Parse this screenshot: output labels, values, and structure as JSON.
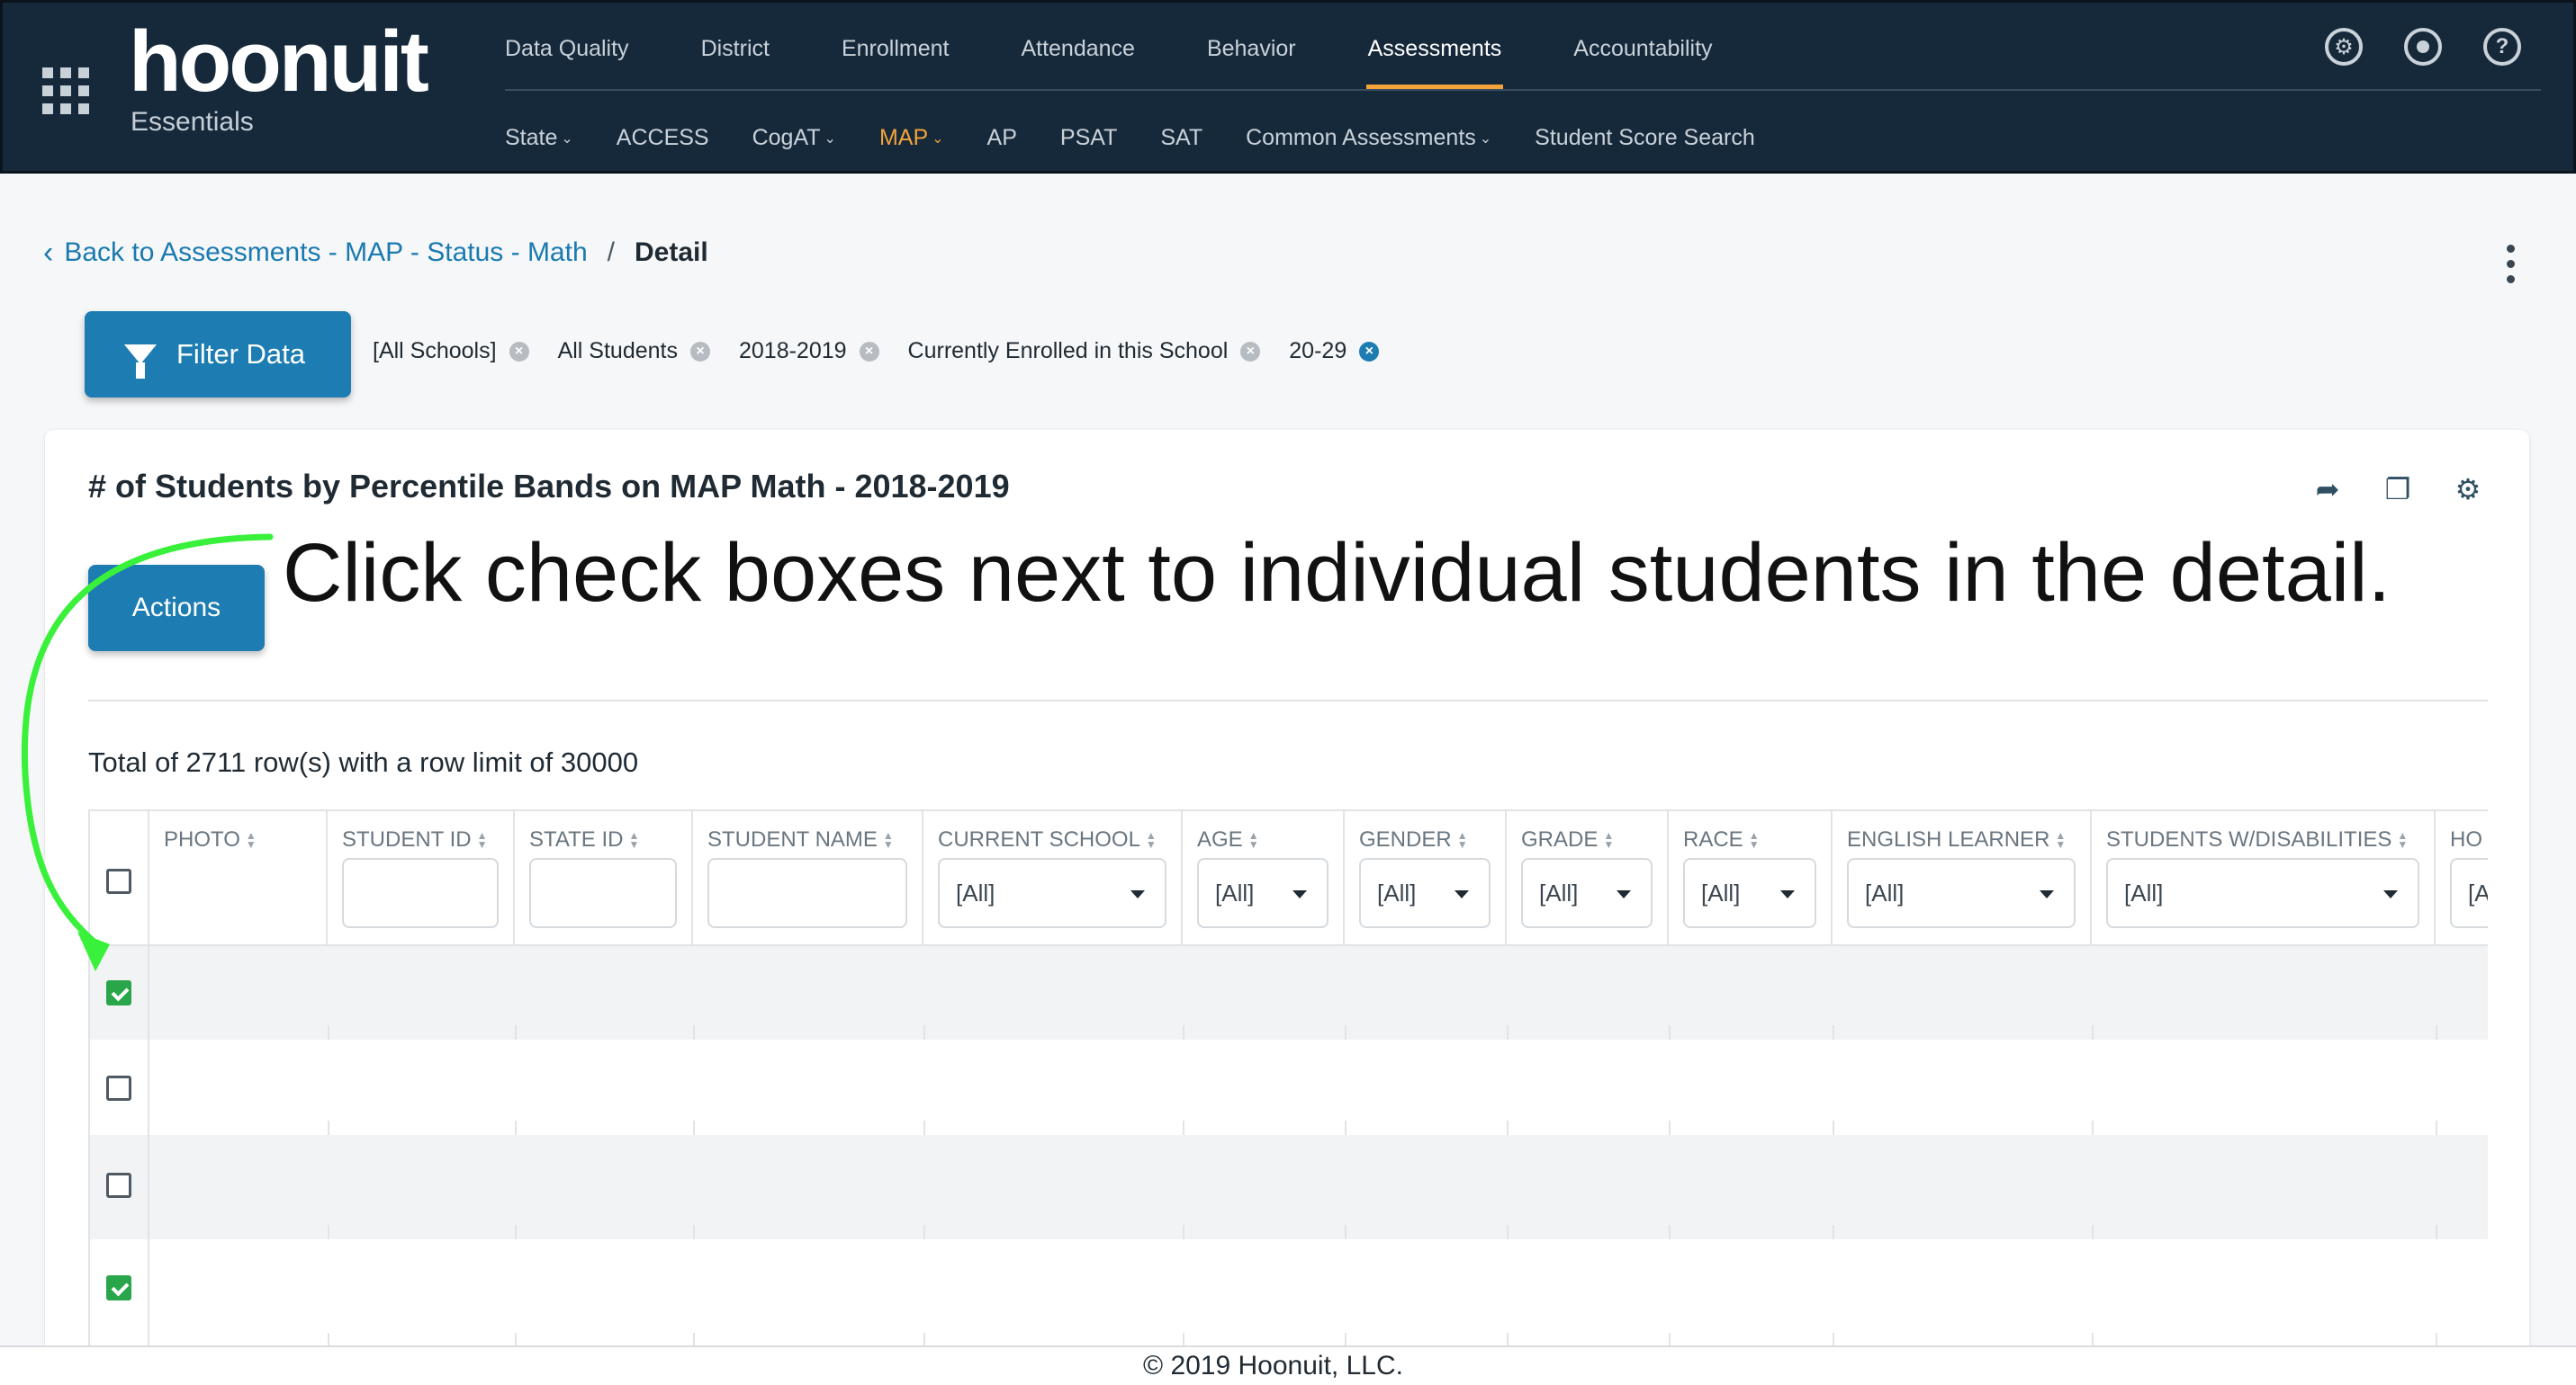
{
  "app": {
    "logo": "hoonuit",
    "logo_sub": "Essentials"
  },
  "nav": {
    "primary": [
      "Data Quality",
      "District",
      "Enrollment",
      "Attendance",
      "Behavior",
      "Assessments",
      "Accountability"
    ],
    "primary_active": "Assessments",
    "secondary": [
      "State",
      "ACCESS",
      "CogAT",
      "MAP",
      "AP",
      "PSAT",
      "SAT",
      "Common Assessments",
      "Student Score Search"
    ],
    "secondary_active": "MAP"
  },
  "header_icons": [
    "wrench-icon",
    "user-icon",
    "help-icon"
  ],
  "breadcrumb": {
    "back_label": "Back to Assessments - MAP - Status - Math",
    "separator": "/",
    "current": "Detail"
  },
  "filter": {
    "button_label": "Filter Data",
    "chips": [
      "[All Schools]",
      "All Students",
      "2018-2019",
      "Currently Enrolled in this School",
      "20-29"
    ]
  },
  "card": {
    "title": "# of Students by Percentile Bands on MAP Math - 2018-2019",
    "actions_label": "Actions",
    "annotation": "Click check boxes next to individual students in the detail.",
    "total_text": "Total of 2711 row(s) with a row limit of 30000"
  },
  "table": {
    "columns": [
      {
        "label": "PHOTO",
        "filter": "none"
      },
      {
        "label": "STUDENT ID",
        "filter": "text"
      },
      {
        "label": "STATE ID",
        "filter": "text"
      },
      {
        "label": "STUDENT NAME",
        "filter": "text"
      },
      {
        "label": "CURRENT SCHOOL",
        "filter": "select",
        "value": "[All]"
      },
      {
        "label": "AGE",
        "filter": "select",
        "value": "[All]"
      },
      {
        "label": "GENDER",
        "filter": "select",
        "value": "[All]"
      },
      {
        "label": "GRADE",
        "filter": "select",
        "value": "[All]"
      },
      {
        "label": "RACE",
        "filter": "select",
        "value": "[All]"
      },
      {
        "label": "ENGLISH LEARNER",
        "filter": "select",
        "value": "[All]"
      },
      {
        "label": "STUDENTS W/DISABILITIES",
        "filter": "select",
        "value": "[All]"
      },
      {
        "label": "HO",
        "filter": "select",
        "value": "[A"
      }
    ],
    "rows_checked": [
      true,
      false,
      false,
      true
    ]
  },
  "colors": {
    "header_bg": "#16293a",
    "accent": "#f3a33a",
    "primary_button": "#1d7db2",
    "check_green": "#2aa64a",
    "annotation_arrow": "#39f03a"
  },
  "footer": {
    "text": "© 2019 Hoonuit, LLC."
  }
}
